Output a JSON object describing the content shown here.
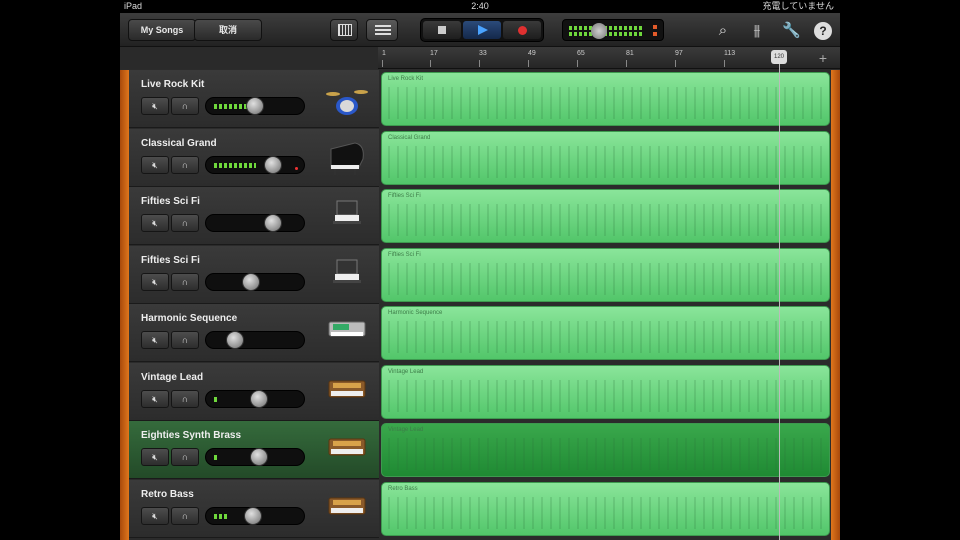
{
  "status_bar": {
    "device": "iPad",
    "time": "2:40",
    "battery_text": "充電していません"
  },
  "toolbar": {
    "my_songs_label": "My Songs",
    "tracks_label": "取消"
  },
  "ruler": {
    "ticks": [
      "1",
      "17",
      "33",
      "49",
      "65",
      "81",
      "97",
      "113"
    ],
    "playhead_label": "120"
  },
  "tracks": [
    {
      "name": "Live Rock Kit",
      "region_label": "Live Rock Kit",
      "instrument": "drum-kit-icon",
      "meter_level": 0.45,
      "knob": 0.5,
      "selected": false
    },
    {
      "name": "Classical Grand",
      "region_label": "Classical Grand",
      "instrument": "grand-piano-icon",
      "meter_level": 0.5,
      "knob": 0.72,
      "selected": false
    },
    {
      "name": "Fifties Sci Fi",
      "region_label": "Fifties Sci Fi",
      "instrument": "synth-keyboard-icon",
      "meter_level": 0,
      "knob": 0.72,
      "selected": false
    },
    {
      "name": "Fifties Sci Fi",
      "region_label": "Fifties Sci Fi",
      "instrument": "synth-keyboard-icon",
      "meter_level": 0,
      "knob": 0.45,
      "selected": false
    },
    {
      "name": "Harmonic Sequence",
      "region_label": "Harmonic Sequence",
      "instrument": "keyboard-icon",
      "meter_level": 0,
      "knob": 0.25,
      "selected": false
    },
    {
      "name": "Vintage Lead",
      "region_label": "Vintage Lead",
      "instrument": "vintage-synth-icon",
      "meter_level": 0.05,
      "knob": 0.55,
      "selected": false
    },
    {
      "name": "Eighties Synth Brass",
      "region_label": "Vintage Lead",
      "instrument": "vintage-synth-icon",
      "meter_level": 0.05,
      "knob": 0.55,
      "selected": true
    },
    {
      "name": "Retro Bass",
      "region_label": "Retro Bass",
      "instrument": "vintage-synth-icon",
      "meter_level": 0.15,
      "knob": 0.48,
      "selected": false
    }
  ],
  "colors": {
    "region_green": "#6fd87f",
    "selected_green": "#2a9a3e",
    "accent_orange": "#e0761c"
  }
}
